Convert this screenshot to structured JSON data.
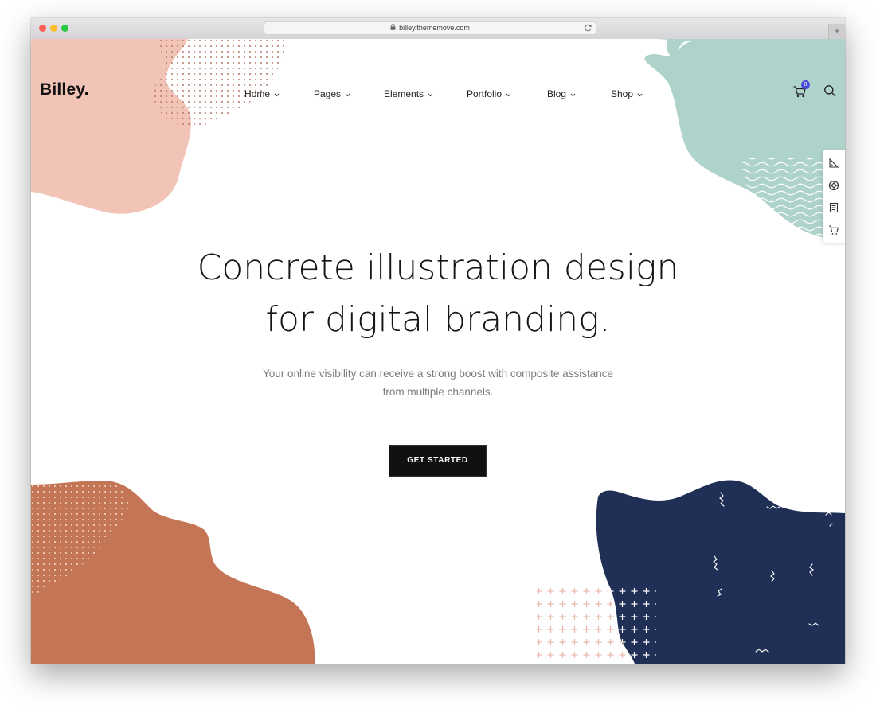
{
  "browser": {
    "url": "billey.thememove.com",
    "lock_icon": "lock-icon",
    "reload_icon": "reload-icon",
    "new_tab_symbol": "+"
  },
  "site": {
    "logo": "Billey."
  },
  "nav": {
    "items": [
      {
        "label": "Home"
      },
      {
        "label": "Pages"
      },
      {
        "label": "Elements"
      },
      {
        "label": "Portfolio"
      },
      {
        "label": "Blog"
      },
      {
        "label": "Shop"
      }
    ]
  },
  "header": {
    "cart_icon": "cart-icon",
    "cart_count": "0",
    "search_icon": "search-icon"
  },
  "side_toolbar": {
    "icons": [
      "ruler-icon",
      "support-icon",
      "document-icon",
      "cart-icon"
    ]
  },
  "hero": {
    "headline_line1": "Concrete illustration design",
    "headline_line2": "for digital branding.",
    "subtext_line1": "Your online visibility can receive a strong boost with composite assistance",
    "subtext_line2": "from multiple channels.",
    "cta_label": "GET STARTED"
  },
  "colors": {
    "accent_blob_pink": "#f2c4b8",
    "accent_blob_mint": "#aed3cb",
    "accent_blob_terracotta": "#c47555",
    "accent_blob_navy": "#1f2f55",
    "badge": "#4b4bd8",
    "button": "#111111"
  }
}
